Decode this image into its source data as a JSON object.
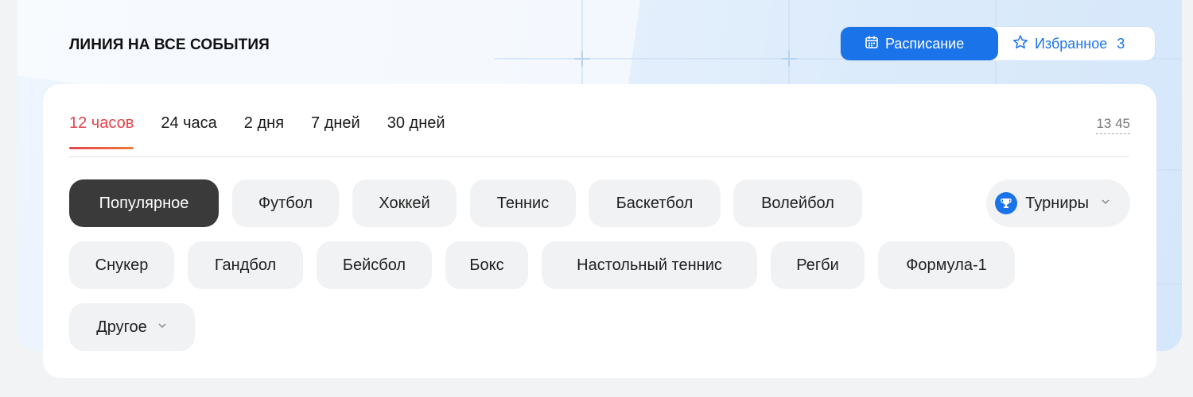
{
  "header": {
    "title": "ЛИНИЯ НА ВСЕ СОБЫТИЯ",
    "schedule_label": "Расписание",
    "favorites_label": "Избранное",
    "favorites_count": "3"
  },
  "period_tabs": [
    {
      "label": "12 часов",
      "active": true
    },
    {
      "label": "24 часа",
      "active": false
    },
    {
      "label": "2 дня",
      "active": false
    },
    {
      "label": "7 дней",
      "active": false
    },
    {
      "label": "30 дней",
      "active": false
    }
  ],
  "clock": "13 45",
  "sports_row1": [
    "Популярное",
    "Футбол",
    "Хоккей",
    "Теннис",
    "Баскетбол",
    "Волейбол"
  ],
  "sports_row2": [
    "Снукер",
    "Гандбол",
    "Бейсбол",
    "Бокс",
    "Настольный теннис",
    "Регби",
    "Формула-1"
  ],
  "sports_row3": [
    "Другое"
  ],
  "tournaments_label": "Турниры",
  "icons": {
    "schedule": "calendar-icon",
    "favorites": "star-icon",
    "tournaments": "trophy-icon",
    "dropdown": "chevron-down-icon"
  },
  "colors": {
    "accent_blue": "#1a73e8",
    "active_tab_red": "#e5434d",
    "selected_chip": "#3a3a3a"
  }
}
